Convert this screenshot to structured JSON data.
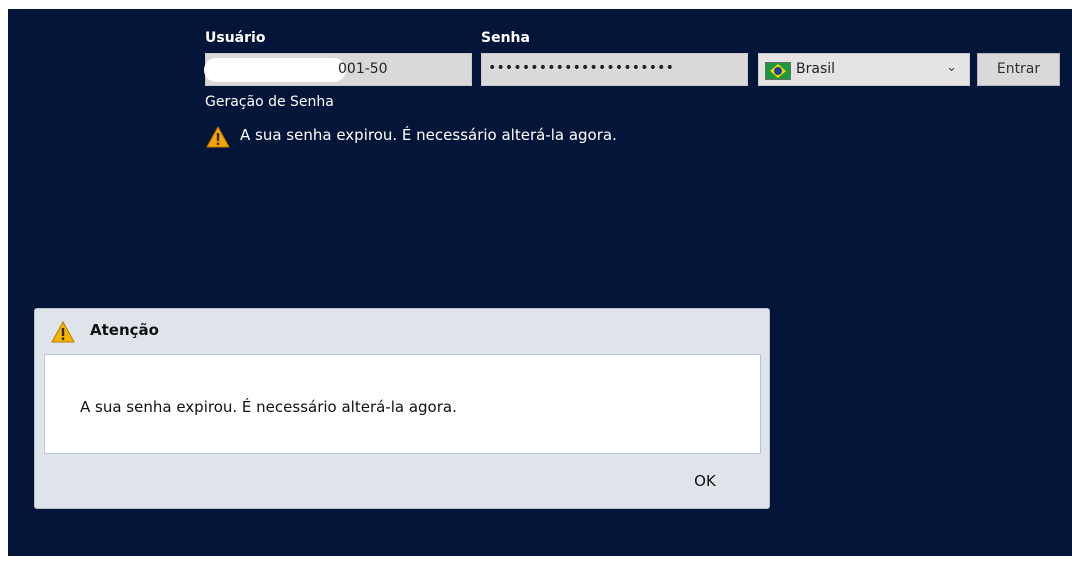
{
  "login": {
    "user_label": "Usuário",
    "user_value": "001-50",
    "password_label": "Senha",
    "password_value": "••••••••••••••••••••••",
    "language_selected": "Brasil",
    "language_flag": "brazil-flag-icon",
    "submit_label": "Entrar",
    "password_generation_link": "Geração de Senha",
    "warning_message": "A sua senha expirou. É necessário alterá-la agora."
  },
  "dialog": {
    "title": "Atenção",
    "message": "A sua senha expirou. É necessário alterá-la agora.",
    "ok_label": "OK",
    "icon": "warning-icon"
  },
  "colors": {
    "background": "#03163a",
    "field": "#d9d9d9",
    "warning": "#f4a300",
    "dialog": "#dfe3ea"
  }
}
